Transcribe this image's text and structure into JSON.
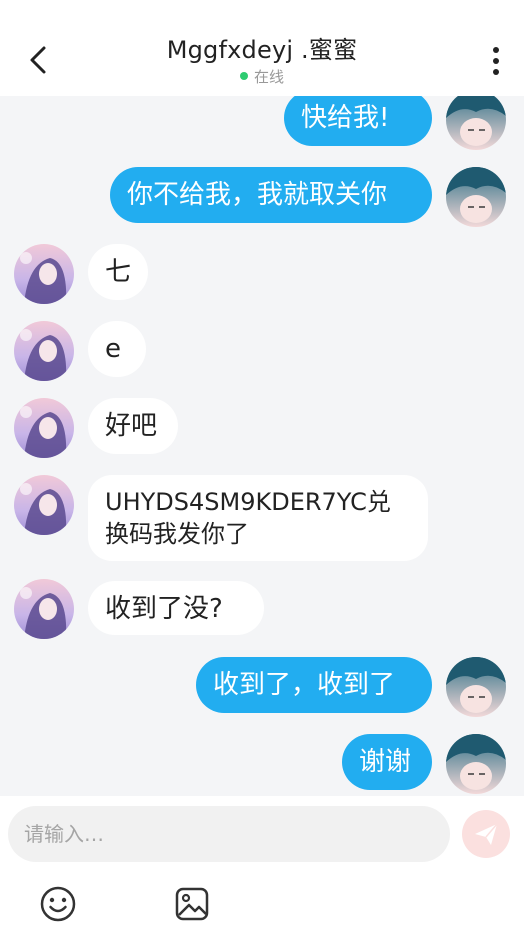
{
  "header": {
    "title": "Mggfxdeyj .蜜蜜",
    "status": "在线"
  },
  "messages": [
    {
      "side": "out",
      "text": "快给我!"
    },
    {
      "side": "out",
      "text": "你不给我，我就取关你"
    },
    {
      "side": "in",
      "text": "七"
    },
    {
      "side": "in",
      "text": "e"
    },
    {
      "side": "in",
      "text": "好吧"
    },
    {
      "side": "in",
      "text_line1": "UHYDS4SM9KDER7YC兑",
      "text_line2": "换码我发你了"
    },
    {
      "side": "in",
      "text": "收到了没?"
    },
    {
      "side": "out",
      "text": "收到了，收到了"
    },
    {
      "side": "out",
      "text": "谢谢"
    }
  ],
  "composer": {
    "placeholder": "请输入…"
  },
  "icons": {
    "back": "chevron-left-icon",
    "more": "more-vertical-icon",
    "send": "paper-plane-icon",
    "emoji": "smiley-icon",
    "image": "image-icon"
  },
  "colors": {
    "outgoing_bubble": "#22adf0",
    "incoming_bubble": "#ffffff",
    "background": "#f4f5f7",
    "online": "#2ecc71",
    "send_button": "#fbe0df"
  }
}
